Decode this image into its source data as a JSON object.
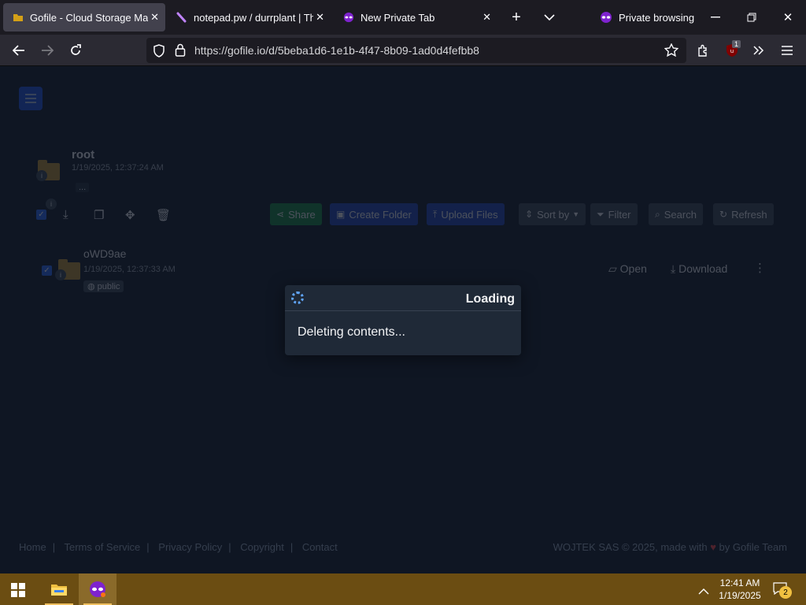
{
  "tabs": [
    {
      "title": "Gofile - Cloud Storage Made",
      "active": true
    },
    {
      "title": "notepad.pw / durrplant | The",
      "active": false
    },
    {
      "title": "New Private Tab",
      "active": false
    }
  ],
  "window": {
    "private_label": "Private browsing"
  },
  "address_bar": {
    "url": "https://gofile.io/d/5beba1d6-1e1b-4f47-8b09-1ad0d4fefbb8"
  },
  "extension_badge": "1",
  "folder": {
    "name": "root",
    "date": "1/19/2025, 12:37:24 AM",
    "more": "..."
  },
  "toolbar": {
    "share": "Share",
    "create_folder": "Create Folder",
    "upload_files": "Upload Files",
    "sort_by": "Sort by",
    "filter": "Filter",
    "search": "Search",
    "refresh": "Refresh"
  },
  "items": [
    {
      "name": "oWD9ae",
      "date": "1/19/2025, 12:37:33 AM",
      "badge": "public",
      "open": "Open",
      "download": "Download"
    }
  ],
  "modal": {
    "title": "Loading",
    "message": "Deleting contents..."
  },
  "footer": {
    "links": [
      "Home",
      "Terms of Service",
      "Privacy Policy",
      "Copyright",
      "Contact"
    ],
    "company_prefix": "WOJTEK SAS © 2025, made with",
    "company_suffix": "by Gofile Team"
  },
  "taskbar": {
    "time": "12:41 AM",
    "date": "1/19/2025",
    "notifications": "2",
    "color": "#6b4d12"
  },
  "colors": {
    "accent": "#2563eb",
    "share_green": "#15803d",
    "modal_bg": "#1f2937"
  }
}
